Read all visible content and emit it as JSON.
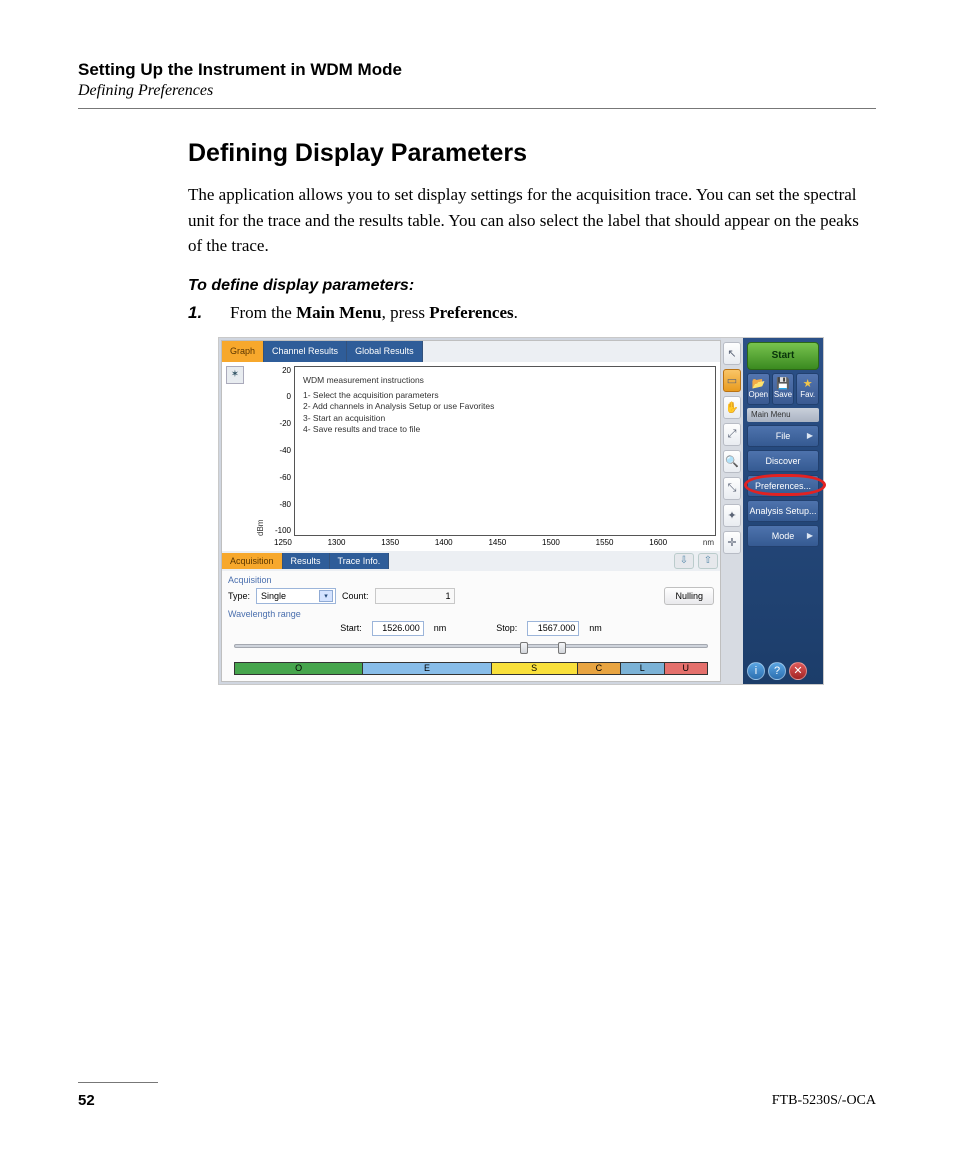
{
  "doc": {
    "chapter": "Setting Up the Instrument in WDM Mode",
    "section": "Defining Preferences",
    "heading": "Defining Display Parameters",
    "body": "The application allows you to set display settings for the acquisition trace. You can set the spectral unit for the trace and the results table. You can also select the label that should appear on the peaks of the trace.",
    "subheading": "To define display parameters:",
    "step_num": "1.",
    "step_text_prefix": "From the ",
    "step_text_b1": "Main Menu",
    "step_text_mid": ", press ",
    "step_text_b2": "Preferences",
    "step_text_suffix": ".",
    "page": "52",
    "product": "FTB-5230S/-OCA"
  },
  "chart_data": {
    "type": "line",
    "title": "WDM measurement instructions",
    "instructions": [
      "1- Select the acquisition parameters",
      "2- Add channels in Analysis Setup or use Favorites",
      "3- Start an acquisition",
      "4- Save results and trace to file"
    ],
    "xlabel": "nm",
    "ylabel": "dBm",
    "xlim": [
      1250,
      1650
    ],
    "ylim": [
      -100,
      20
    ],
    "x_ticks": [
      1250,
      1300,
      1350,
      1400,
      1450,
      1500,
      1550,
      1600
    ],
    "y_ticks": [
      20,
      0,
      -20,
      -40,
      -60,
      -80,
      -100
    ],
    "series": []
  },
  "ui": {
    "top_tabs": [
      "Graph",
      "Channel Results",
      "Global Results"
    ],
    "bottom_tabs": [
      "Acquisition",
      "Results",
      "Trace Info."
    ],
    "x_unit": "nm",
    "acq": {
      "panel_label": "Acquisition",
      "type_label": "Type:",
      "type_value": "Single",
      "count_label": "Count:",
      "count_value": "1",
      "nulling": "Nulling",
      "wl_label": "Wavelength range",
      "start_label": "Start:",
      "start_value": "1526.000",
      "stop_label": "Stop:",
      "stop_value": "1567.000",
      "unit": "nm"
    },
    "bands": [
      {
        "label": "O",
        "color": "#46a54d"
      },
      {
        "label": "E",
        "color": "#88bde9"
      },
      {
        "label": "S",
        "color": "#f9e03b"
      },
      {
        "label": "C",
        "color": "#e8a441"
      },
      {
        "label": "L",
        "color": "#7bb2d6"
      },
      {
        "label": "U",
        "color": "#e4706c"
      }
    ],
    "right": {
      "start": "Start",
      "open": "Open",
      "save": "Save",
      "fav": "Fav.",
      "main_menu": "Main Menu",
      "file": "File",
      "discover": "Discover",
      "preferences": "Preferences...",
      "analysis": "Analysis Setup...",
      "mode": "Mode"
    }
  }
}
